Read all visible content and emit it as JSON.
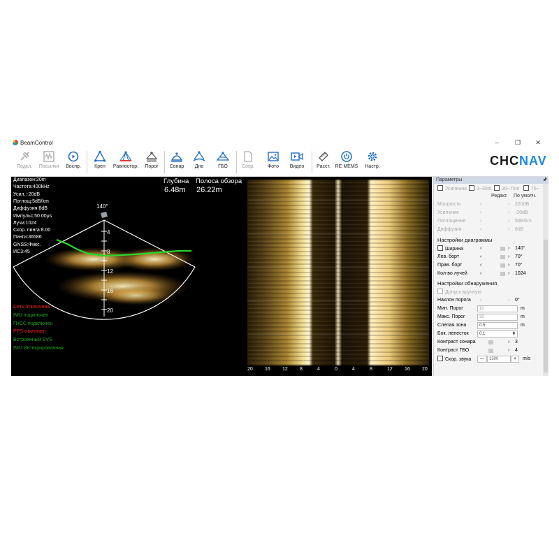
{
  "window": {
    "title": "BeamControl",
    "minimize": "–",
    "maximize": "❐",
    "close": "✕"
  },
  "toolbar": {
    "connect": "Подкл.",
    "send": "Посылки",
    "playback": "Воспр.",
    "roll": "Крен",
    "balance": "Равностор.",
    "threshold": "Порог",
    "sonar": "Сонар",
    "bottom": "Дно",
    "gbo": "ГБО",
    "save": "Сохр.",
    "photo": "Фото",
    "video": "Видео",
    "distance": "Расст.",
    "re_mems": "RE MEMS",
    "settings": "Настр."
  },
  "logo": {
    "part1": "CHC",
    "part2": "NAV"
  },
  "sonar": {
    "info": [
      "Диапазон:20m",
      "Частота:400kHz",
      "Усил.:-20dB",
      "Поглощ:5dB/km",
      "Диффузия:8dB",
      "Импульс:50.00μs",
      "Лучи:1024",
      "Скор. пинга:8.00",
      "Пинги:36586",
      "GNSS:Фикс.",
      "ИС3:45"
    ],
    "status": [
      {
        "text": "Сеть отключена",
        "color": "#ff2020"
      },
      {
        "text": "IMU подключен",
        "color": "#1fa51f"
      },
      {
        "text": "ГНСС подключен",
        "color": "#1fa51f"
      },
      {
        "text": "PPS отключен",
        "color": "#ff2020"
      },
      {
        "text": "Встроенный SVS",
        "color": "#1fa51f"
      },
      {
        "text": "IMU Интегрированная",
        "color": "#1fa51f"
      }
    ],
    "depth_label": "Глубина",
    "depth_value": "6.48m",
    "swath_label": "Полоса обзора",
    "swath_value": "26.22m",
    "angle": "140°",
    "scale": [
      "4",
      "8",
      "12",
      "16",
      "20"
    ]
  },
  "waterfall": {
    "ticks": [
      "20",
      "16",
      "12",
      "8",
      "4",
      "0",
      "4",
      "8",
      "12",
      "16",
      "20"
    ]
  },
  "params": {
    "title": "Параметры",
    "gain_row": {
      "label": "Усиления",
      "opt1": "3~30m",
      "opt2": "30~75m",
      "opt3": "75~"
    },
    "edit_header": "Редакт.",
    "default_header": "По умолч.",
    "top_rows": [
      {
        "label": "Мощность",
        "value": "220dB"
      },
      {
        "label": "Усиление",
        "value": "-20dB"
      },
      {
        "label": "Поглощение",
        "value": "5dB/km"
      },
      {
        "label": "Диффузия",
        "value": "8dB"
      }
    ],
    "diagram_section": "Настройки диаграммы",
    "diagram_rows": [
      {
        "label": "Ширина",
        "value": "140°"
      },
      {
        "label": "Лев. борт",
        "value": "70°"
      },
      {
        "label": "Прав. борт",
        "value": "70°"
      },
      {
        "label": "Кол-во лучей",
        "value": "1024"
      }
    ],
    "detect_section": "Настройки обнаружения",
    "manual_tol": "Допуск вручную",
    "tilt": {
      "label": "Наклон порога",
      "value": "0°"
    },
    "min_thr": {
      "label": "Мин. Порог",
      "value": "10",
      "unit": "m"
    },
    "max_thr": {
      "label": "Макс. Порог",
      "value": "30",
      "unit": "m"
    },
    "blind": {
      "label": "Слепая зона",
      "value": "0.5",
      "unit": "m"
    },
    "side_lobe": {
      "label": "Бок. лепесток",
      "value": "0.1"
    },
    "sonar_contrast": {
      "label": "Контраст сонара",
      "value": "3"
    },
    "gbo_contrast": {
      "label": "Контраст ГБО",
      "value": "4"
    },
    "sound_speed": {
      "label": "Скор. звука",
      "minus": "—",
      "value": "1500",
      "plus": "+",
      "unit": "m/s"
    }
  }
}
